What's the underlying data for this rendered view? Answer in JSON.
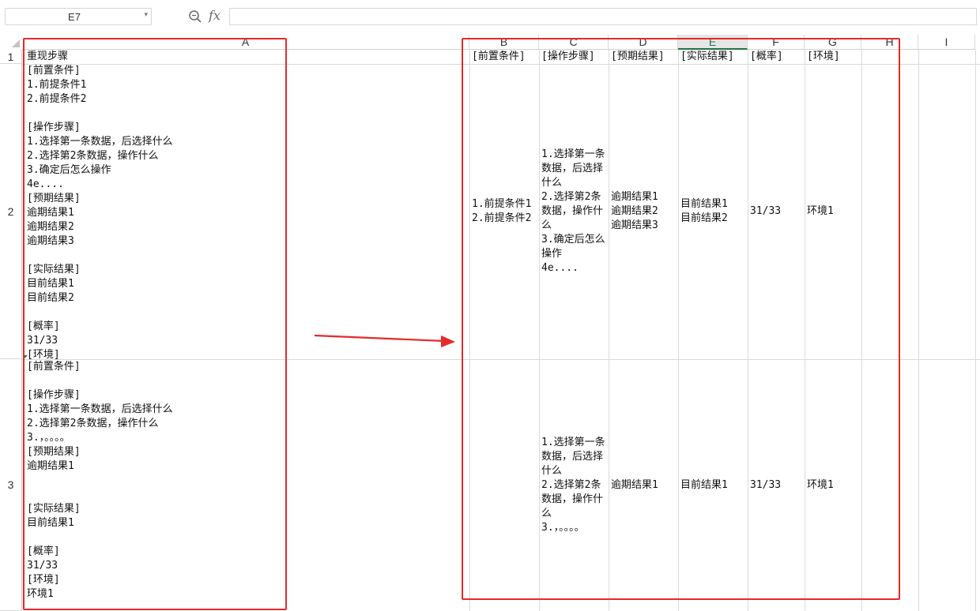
{
  "formula_bar": {
    "name_box": "E7",
    "fx_label": "fx",
    "formula_value": "",
    "icons": {
      "zoom": "zoom-icon",
      "dropdown": "chevron-down-icon"
    }
  },
  "columns": [
    "A",
    "B",
    "C",
    "D",
    "E",
    "F",
    "G",
    "H",
    "I"
  ],
  "active_column": "E",
  "rows": [
    "1",
    "2",
    "3"
  ],
  "cells": {
    "A1": "重现步骤",
    "A2": "[前置条件]\n1.前提条件1\n2.前提条件2\n\n[操作步骤]\n1.选择第一条数据，后选择什么\n2.选择第2条数据，操作什么\n3.确定后怎么操作\n4e....\n[预期结果]\n逾期结果1\n逾期结果2\n逾期结果3\n\n[实际结果]\n目前结果1\n目前结果2\n\n[概率]\n31/33\n[环境]",
    "A3": "[前置条件]\n\n[操作步骤]\n1.选择第一条数据，后选择什么\n2.选择第2条数据，操作什么\n3.，。。。。\n[预期结果]\n逾期结果1\n\n\n[实际结果]\n目前结果1\n\n[概率]\n31/33\n[环境]\n环境1",
    "B1": "[前置条件]",
    "C1": "[操作步骤]",
    "D1": "[预期结果]",
    "E1": "[实际结果]",
    "F1": "[概率]",
    "G1": "[环境]",
    "B2": "1.前提条件1\n2.前提条件2",
    "C2": "1.选择第一条数据，后选择什么\n2.选择第2条数据，操作什么\n3.确定后怎么操作\n4e....",
    "D2": "逾期结果1\n逾期结果2\n逾期结果3",
    "E2": "目前结果1\n目前结果2",
    "F2": "31/33",
    "G2": "环境1",
    "B3": "",
    "C3": "1.选择第一条数据，后选择什么\n2.选择第2条数据，操作什么\n3.，。。。。",
    "D3": "逾期结果1",
    "E3": "目前结果1",
    "F3": "31/33",
    "G3": "环境1"
  },
  "annotation_colors": {
    "highlight": "#e52a2a",
    "active_header": "#217346"
  }
}
